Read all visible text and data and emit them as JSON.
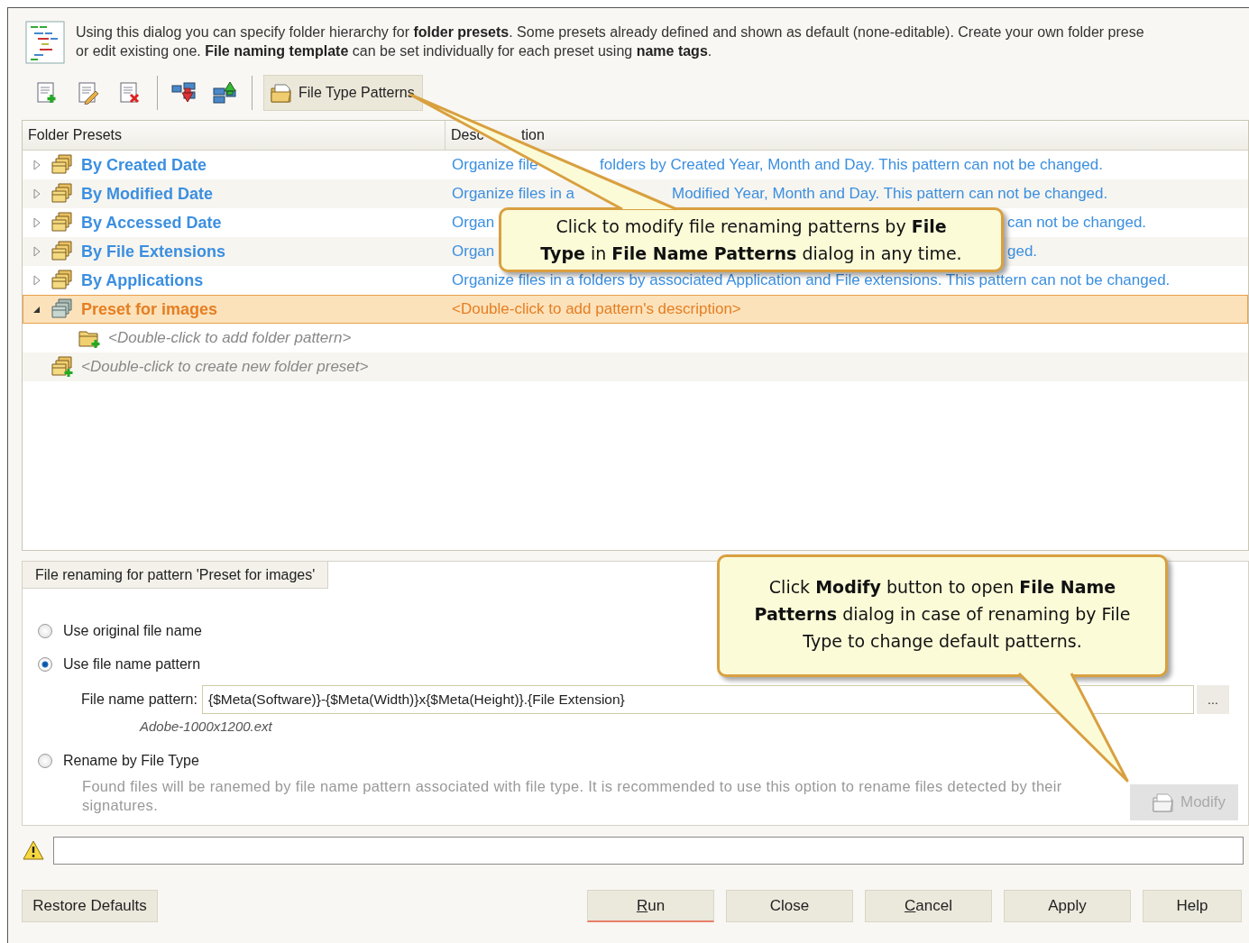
{
  "intro": {
    "lines": [
      "Using this dialog you can specify folder hierarchy for **folder presets**. Some presets already defined and shown as default (none-editable). Create your own folder prese",
      "or edit existing one. **File naming template** can be set individually for each preset using **name tags**."
    ]
  },
  "toolbar": {
    "tools": [
      {
        "kind": "add"
      },
      {
        "kind": "edit"
      },
      {
        "kind": "delete"
      },
      {
        "kind": "separator"
      },
      {
        "kind": "move-down"
      },
      {
        "kind": "move-up"
      },
      {
        "kind": "separator"
      },
      {
        "kind": "button",
        "label": "File Type Patterns"
      }
    ]
  },
  "grid": {
    "columns": [
      [
        "Folder Presets"
      ],
      [
        "Desc",
        "tion"
      ]
    ],
    "rows": [
      {
        "kind": "preset",
        "name": "By Created Date",
        "expanded": false,
        "selected": false,
        "description": [
          "Organize file",
          "folders by Created Year, Month and Day. This pattern can not be changed."
        ]
      },
      {
        "kind": "preset",
        "name": "By Modified Date",
        "expanded": false,
        "selected": false,
        "description": [
          "Organize files in a",
          "Modified Year, Month and Day. This pattern can not be changed."
        ]
      },
      {
        "kind": "preset",
        "name": "By Accessed Date",
        "expanded": false,
        "selected": false,
        "description": [
          "Organ",
          "can not be changed."
        ]
      },
      {
        "kind": "preset",
        "name": "By File Extensions",
        "expanded": false,
        "selected": false,
        "description": [
          "Organ",
          "ged."
        ]
      },
      {
        "kind": "preset",
        "name": "By Applications",
        "expanded": false,
        "selected": false,
        "description": [
          "Organize files in a folders by associated Application and File extensions. This pattern can not be changed."
        ]
      },
      {
        "kind": "preset",
        "name": "Preset for images",
        "expanded": true,
        "selected": true,
        "description": [
          "<Double-click to add pattern's description>"
        ],
        "children": [
          {
            "kind": "add-folder",
            "name": "<Double-click to add folder pattern>",
            "selected": false
          }
        ]
      },
      {
        "kind": "add-preset",
        "name": "<Double-click to create new folder preset>",
        "selected": false
      }
    ]
  },
  "renaming": {
    "title": "File renaming for pattern 'Preset for images'",
    "options": [
      {
        "label": "Use original file name",
        "selected": false
      },
      {
        "label": "Use file name pattern",
        "selected": true
      },
      {
        "label": "Rename by File Type",
        "selected": false
      }
    ],
    "pattern_label": "File name pattern:",
    "pattern_value": "{$Meta(Software)}-{$Meta(Width)}x{$Meta(Height)}.{File Extension}",
    "browse_label": "...",
    "preview": "Adobe-1000x1200.ext",
    "type_note": "Found files will be ranemed by file name pattern associated with file type. It is recommended to use this option to rename files detected by their signatures.",
    "type_note_disabled": true,
    "modify": {
      "label": "Modify",
      "disabled": true
    }
  },
  "status": {
    "warning": true,
    "message_placeholder_shown": true
  },
  "buttons": [
    {
      "label": "Restore Defaults",
      "default": false,
      "underline_first": false
    },
    {
      "label": "Run",
      "default": true,
      "underline_first": true
    },
    {
      "label": "Close",
      "default": false,
      "underline_first": false
    },
    {
      "label": "Cancel",
      "default": false,
      "underline_first": true
    },
    {
      "label": "Apply",
      "default": false,
      "underline_first": false
    },
    {
      "label": "Help",
      "default": false,
      "underline_first": false
    }
  ],
  "callouts": [
    {
      "text": "Click to modify file renaming patterns by **File**\n**Type** in **File Name Patterns** dialog in any time."
    },
    {
      "text": "Click **Modify** button to open **File Name**\n**Patterns** dialog in case of renaming by File\nType to change default patterns."
    }
  ]
}
